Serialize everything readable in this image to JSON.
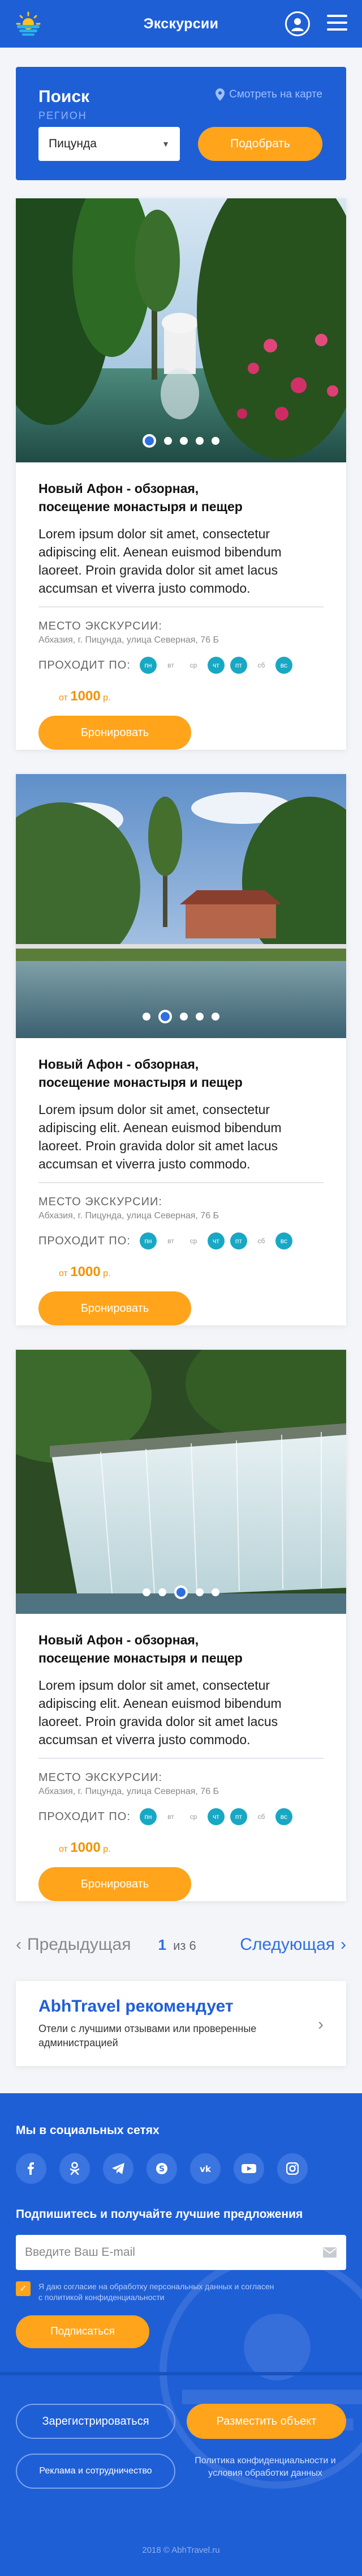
{
  "header": {
    "title": "Экскурсии"
  },
  "search": {
    "title": "Поиск",
    "map_link": "Смотреть на карте",
    "region_label": "РЕГИОН",
    "region_value": "Пицунда",
    "submit": "Подобрать"
  },
  "cards": [
    {
      "title_line1": "Новый Афон - обзорная,",
      "title_line2": "посещение монастыря и пещер",
      "text": "Lorem ipsum dolor sit amet, consectetur adipiscing elit. Aenean euismod bibendum laoreet. Proin gravida dolor sit amet lacus accumsan et viverra justo commodo.",
      "place_label": "МЕСТО ЭКСКУРСИИ:",
      "place": "Абхазия, г. Пицунда, улица Северная, 76 Б",
      "days_label": "ПРОХОДИТ ПО:",
      "price_prefix": "от",
      "price_value": "1000",
      "price_suffix": "р.",
      "book": "Бронировать",
      "active_dot": 0
    },
    {
      "title_line1": "Новый Афон - обзорная,",
      "title_line2": "посещение монастыря и пещер",
      "text": "Lorem ipsum dolor sit amet, consectetur adipiscing elit. Aenean euismod bibendum laoreet. Proin gravida dolor sit amet lacus accumsan et viverra justo commodo.",
      "place_label": "МЕСТО ЭКСКУРСИИ:",
      "place": "Абхазия, г. Пицунда, улица Северная, 76 Б",
      "days_label": "ПРОХОДИТ ПО:",
      "price_prefix": "от",
      "price_value": "1000",
      "price_suffix": "р.",
      "book": "Бронировать",
      "active_dot": 1
    },
    {
      "title_line1": "Новый Афон - обзорная,",
      "title_line2": "посещение монастыря и пещер",
      "text": "Lorem ipsum dolor sit amet, consectetur adipiscing elit. Aenean euismod bibendum laoreet. Proin gravida dolor sit amet lacus accumsan et viverra justo commodo.",
      "place_label": "МЕСТО ЭКСКУРСИИ:",
      "place": "Абхазия, г. Пицунда, улица Северная, 76 Б",
      "days_label": "ПРОХОДИТ ПО:",
      "price_prefix": "от",
      "price_value": "1000",
      "price_suffix": "р.",
      "book": "Бронировать",
      "active_dot": 2
    }
  ],
  "days": [
    {
      "label": "пн",
      "on": true
    },
    {
      "label": "вт",
      "on": false
    },
    {
      "label": "ср",
      "on": false
    },
    {
      "label": "чт",
      "on": true
    },
    {
      "label": "пт",
      "on": true
    },
    {
      "label": "сб",
      "on": false
    },
    {
      "label": "вс",
      "on": true
    }
  ],
  "pager": {
    "prev": "Предыдущая",
    "current": "1",
    "of": "из 6",
    "next": "Следующая"
  },
  "recommend": {
    "title": "AbhTravel рекомендует",
    "text": "Отели с лучшими отзывами или проверенные администрацией"
  },
  "footer": {
    "social_title": "Мы в социальных сетях",
    "social_icons": [
      "facebook-icon",
      "odnoklassniki-icon",
      "telegram-icon",
      "skype-icon",
      "vk-icon",
      "youtube-icon",
      "instagram-icon"
    ],
    "subscribe_title": "Подпишитесь и получайте лучшие предложения",
    "email_placeholder": "Введите Ваш E-mail",
    "consent": "Я даю согласие на обработку персональных данных и согласен с политикой конфиденциальности",
    "subscribe_button": "Подписаться",
    "register_button": "Зарегистрироваться",
    "place_object_button": "Разместить объект",
    "ads_button": "Реклама и сотрудничество",
    "policy": "Политика конфиденциальности и условия обработки данных",
    "copyright": "2018 © AbhTravel.ru"
  },
  "colors": {
    "primary": "#1f5fd6",
    "accent": "#ffa41b",
    "day_on": "#18a8c4"
  }
}
